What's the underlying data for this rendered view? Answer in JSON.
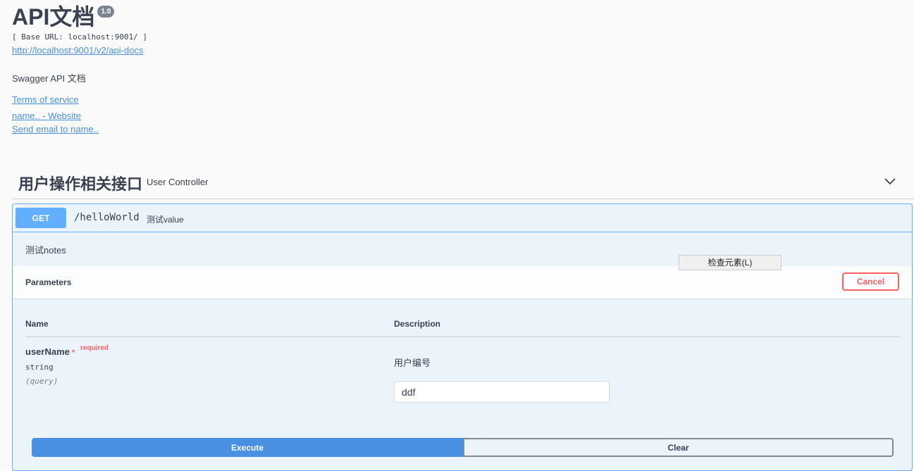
{
  "info": {
    "title": "API文档",
    "version": "1.0",
    "base_url": "[ Base URL: localhost:9001/ ]",
    "api_docs_url": "http://localhost:9001/v2/api-docs",
    "description": "Swagger API 文档",
    "terms_link": "Terms of service",
    "website_link": "name.. - Website",
    "email_link": "Send email to name.."
  },
  "tag": {
    "name": "用户操作相关接口",
    "description": "User Controller",
    "toggle_icon": "chevron-down-icon"
  },
  "operation": {
    "method": "GET",
    "path": "/helloWorld",
    "summary": "测试value",
    "notes": "测试notes",
    "parameters_title": "Parameters",
    "cancel_label": "Cancel",
    "context_menu_item": "检查元素(L)",
    "columns": {
      "name": "Name",
      "description": "Description"
    },
    "parameter": {
      "name": "userName",
      "required_star": "*",
      "required_label": "required",
      "type": "string",
      "in": "(query)",
      "description": "用户编号",
      "value": "ddf"
    },
    "execute_label": "Execute",
    "clear_label": "Clear"
  },
  "colors": {
    "get_method": "#61affe",
    "execute": "#4990e2",
    "cancel": "#ff6060",
    "link": "#4990e2"
  }
}
